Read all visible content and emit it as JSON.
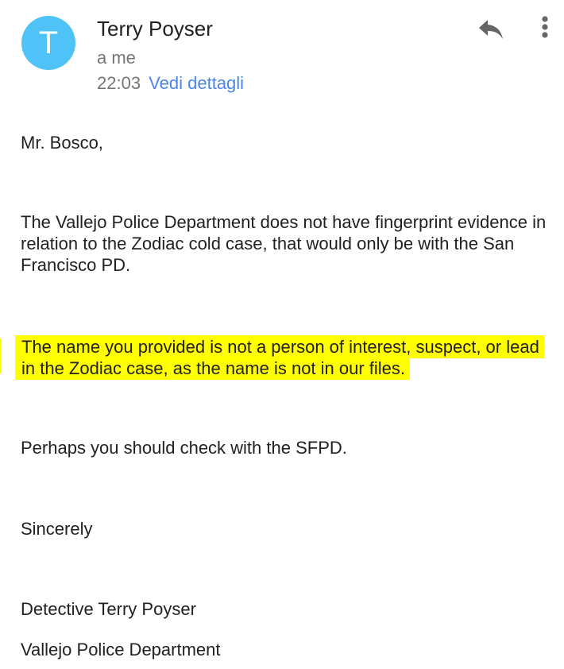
{
  "header": {
    "avatar_letter": "T",
    "avatar_color": "#4fc3f7",
    "sender_name": "Terry Poyser",
    "recipient": "a me",
    "time": "22:03",
    "details_link": "Vedi dettagli",
    "link_color": "#4a86e8",
    "reply_icon": "reply-icon",
    "more_icon": "more-vert-icon"
  },
  "message": {
    "greeting": "Mr. Bosco,",
    "paragraph_1": "The Vallejo Police Department does not have fingerprint evidence in relation to the Zodiac cold case, that would only be with the San Francisco PD.",
    "paragraph_2_highlighted": "The name you provided is not a person of interest, suspect, or lead in the Zodiac case, as the name is not in our files.",
    "highlight_color": "#ffff00",
    "paragraph_3": "Perhaps you should check with the SFPD.",
    "closing": "Sincerely",
    "signature_name": "Detective Terry Poyser",
    "signature_org": "Vallejo Police Department"
  }
}
